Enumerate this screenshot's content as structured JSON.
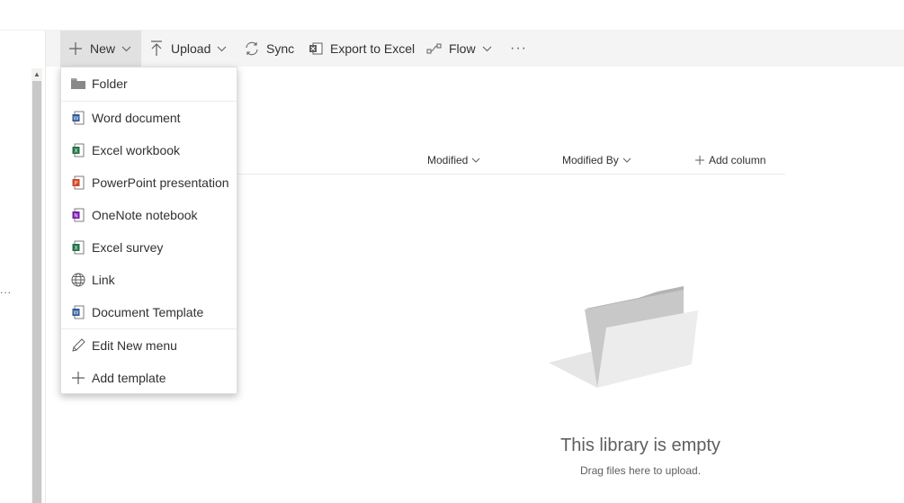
{
  "commandbar": {
    "new_label": "New",
    "upload_label": "Upload",
    "sync_label": "Sync",
    "export_label": "Export to Excel",
    "flow_label": "Flow",
    "more_label": "···"
  },
  "list": {
    "columns": {
      "modified": "Modified",
      "modified_by": "Modified By",
      "add_column": "Add column"
    }
  },
  "empty_state": {
    "title": "This library is empty",
    "subtitle": "Drag files here to upload."
  },
  "left_rail": {
    "ellipsis": "..."
  },
  "new_menu": {
    "items": [
      {
        "label": "Folder",
        "icon": "folder-icon"
      },
      {
        "label": "Word document",
        "icon": "word-icon",
        "color": "#2b579a"
      },
      {
        "label": "Excel workbook",
        "icon": "excel-icon",
        "color": "#217346"
      },
      {
        "label": "PowerPoint presentation",
        "icon": "powerpoint-icon",
        "color": "#d24726"
      },
      {
        "label": "OneNote notebook",
        "icon": "onenote-icon",
        "color": "#7719aa"
      },
      {
        "label": "Excel survey",
        "icon": "excel-icon",
        "color": "#217346"
      },
      {
        "label": "Link",
        "icon": "globe-icon"
      },
      {
        "label": "Document Template",
        "icon": "word-icon",
        "color": "#2b579a"
      },
      {
        "label": "Edit New menu",
        "icon": "pencil-icon"
      },
      {
        "label": "Add template",
        "icon": "plus-icon"
      }
    ]
  }
}
